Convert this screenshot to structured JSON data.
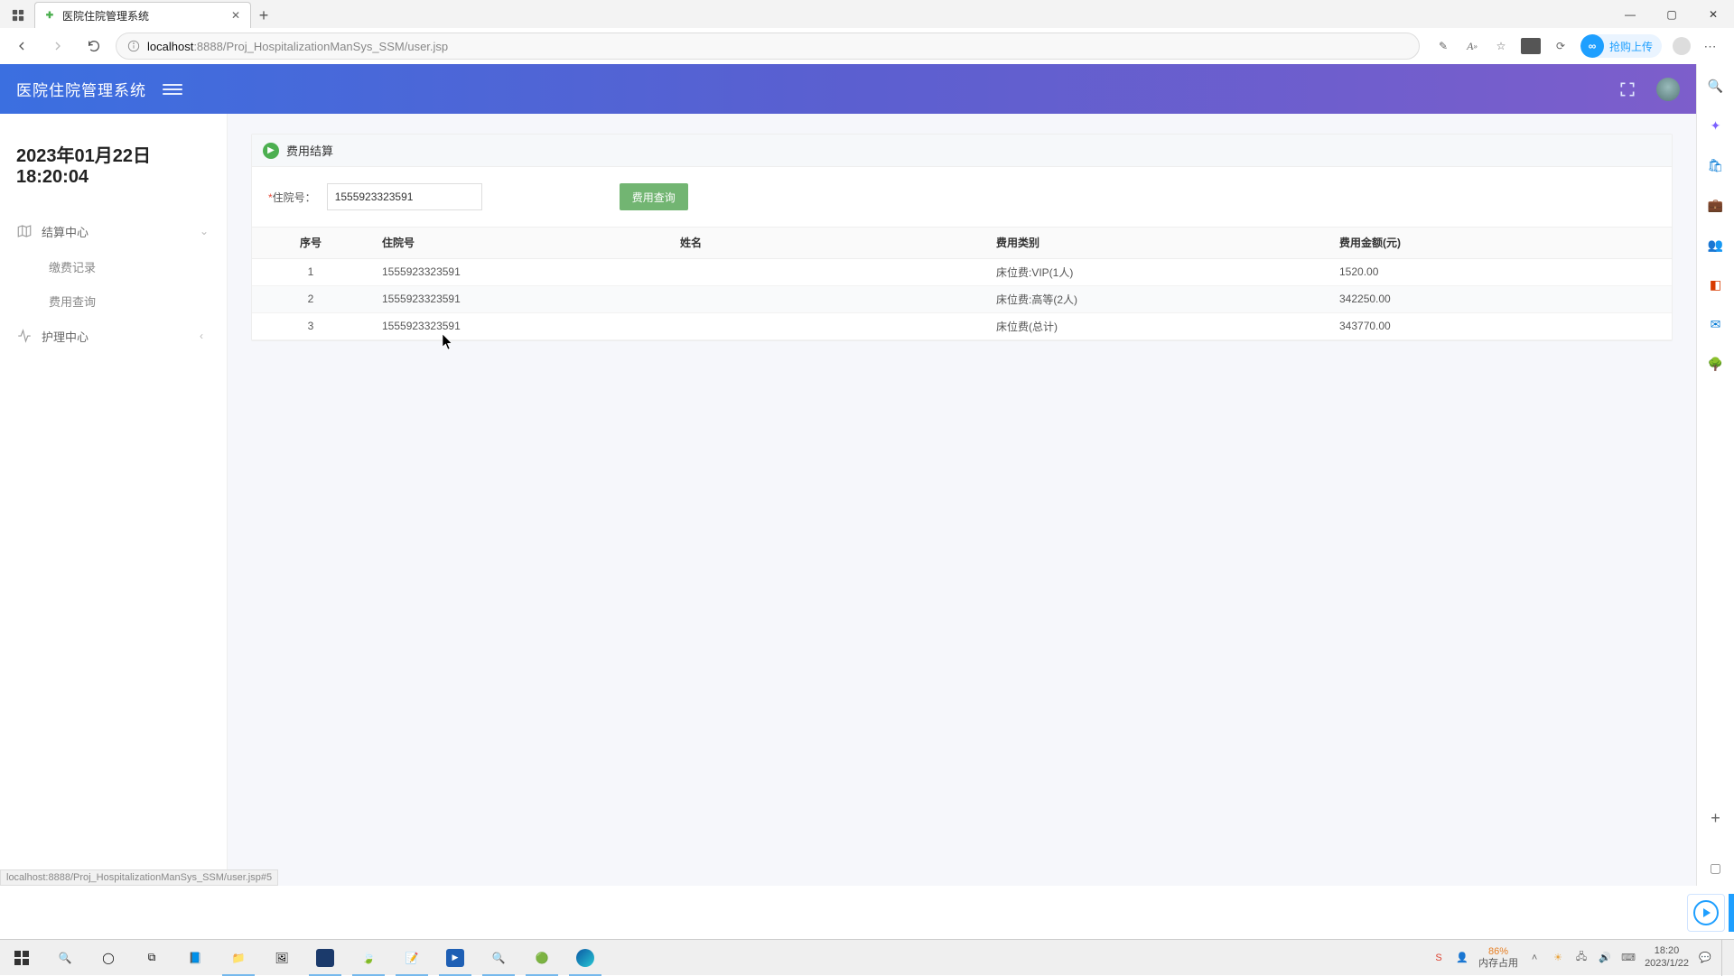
{
  "browser": {
    "tab_title": "医院住院管理系统",
    "url_host": "localhost",
    "url_port": ":8888",
    "url_path": "/Proj_HospitalizationManSys_SSM/user.jsp",
    "ext_pill": "抢购上传",
    "status_hint": "localhost:8888/Proj_HospitalizationManSys_SSM/user.jsp#5"
  },
  "app": {
    "title": "医院住院管理系统",
    "date": "2023年01月22日",
    "time": "18:20:04",
    "menu": {
      "settlement": "结算中心",
      "pay_record": "缴费记录",
      "fee_query": "费用查询",
      "nursing": "护理中心"
    },
    "panel_title": "费用结算",
    "form": {
      "label": "住院号：",
      "value": "1555923323591",
      "query_btn": "费用查询"
    },
    "table": {
      "headers": [
        "序号",
        "住院号",
        "姓名",
        "费用类别",
        "费用金额(元)"
      ],
      "rows": [
        {
          "seq": "1",
          "hosp_no": "1555923323591",
          "name": "",
          "category": "床位费:VIP(1人)",
          "amount": "1520.00"
        },
        {
          "seq": "2",
          "hosp_no": "1555923323591",
          "name": "",
          "category": "床位费:高等(2人)",
          "amount": "342250.00"
        },
        {
          "seq": "3",
          "hosp_no": "1555923323591",
          "name": "",
          "category": "床位费(总计)",
          "amount": "343770.00"
        }
      ]
    }
  },
  "taskbar": {
    "mem_pct": "86%",
    "mem_label": "内存占用",
    "time": "18:20",
    "date": "2023/1/22"
  }
}
